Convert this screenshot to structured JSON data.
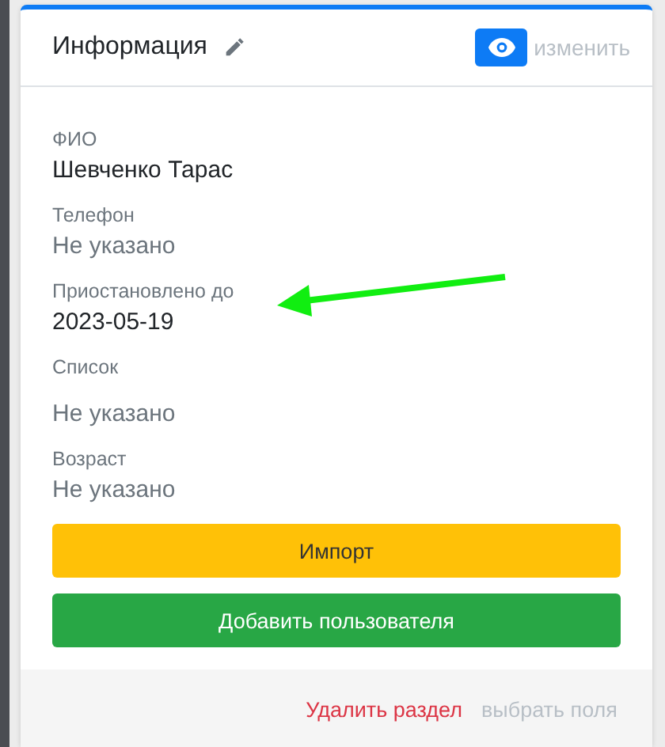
{
  "card": {
    "title": "Информация",
    "edit_link": "изменить"
  },
  "fields": [
    {
      "kind": "text",
      "label": "ФИО",
      "value": "Шевченко Тарас",
      "empty": false
    },
    {
      "kind": "text",
      "label": "Телефон",
      "value": "Не указано",
      "empty": true
    },
    {
      "kind": "text",
      "label": "Приостановлено до",
      "value": "2023-05-19",
      "empty": false
    },
    {
      "kind": "list",
      "label": "Список",
      "value": "Не указано",
      "empty": true
    },
    {
      "kind": "text",
      "label": "Возраст",
      "value": "Не указано",
      "empty": true
    }
  ],
  "buttons": [
    {
      "label": "Импорт",
      "kind": "warning"
    },
    {
      "label": "Добавить пользователя",
      "kind": "success"
    }
  ],
  "footer": {
    "delete_link": "Удалить раздел",
    "fields_link": "выбрать поля"
  }
}
